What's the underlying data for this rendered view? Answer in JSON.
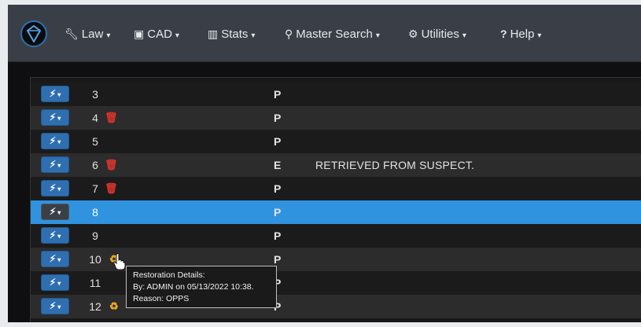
{
  "nav": {
    "items": [
      {
        "label": "Law",
        "icon": "wrench-icon"
      },
      {
        "label": "CAD",
        "icon": "briefcase-icon"
      },
      {
        "label": "Stats",
        "icon": "bar-chart-icon"
      },
      {
        "label": "Master Search",
        "icon": "search-icon"
      },
      {
        "label": "Utilities",
        "icon": "gears-icon"
      },
      {
        "label": "Help",
        "icon": "question-icon"
      }
    ]
  },
  "rows": [
    {
      "num": "3",
      "code": "P",
      "desc": "",
      "status": ""
    },
    {
      "num": "4",
      "code": "P",
      "desc": "",
      "status": "trash-icon"
    },
    {
      "num": "5",
      "code": "P",
      "desc": "",
      "status": ""
    },
    {
      "num": "6",
      "code": "E",
      "desc": "RETRIEVED FROM SUSPECT.",
      "status": "trash-icon"
    },
    {
      "num": "7",
      "code": "P",
      "desc": "",
      "status": "trash-icon"
    },
    {
      "num": "8",
      "code": "P",
      "desc": "",
      "status": "",
      "selected": true
    },
    {
      "num": "9",
      "code": "P",
      "desc": "",
      "status": ""
    },
    {
      "num": "10",
      "code": "P",
      "desc": "",
      "status": "recycle-icon"
    },
    {
      "num": "11",
      "code": "P",
      "desc": "",
      "status": ""
    },
    {
      "num": "12",
      "code": "P",
      "desc": "",
      "status": "recycle-icon"
    }
  ],
  "tooltip": {
    "title": "Restoration Details:",
    "by": "By: ADMIN on 05/13/2022 10:38.",
    "reason": "Reason: OPPS"
  },
  "colors": {
    "navbar": "#3a3f47",
    "accent": "#2f6fb0",
    "selected_row": "#2f93e0",
    "trash": "#d9342b",
    "recycle": "#f0ad1e"
  }
}
